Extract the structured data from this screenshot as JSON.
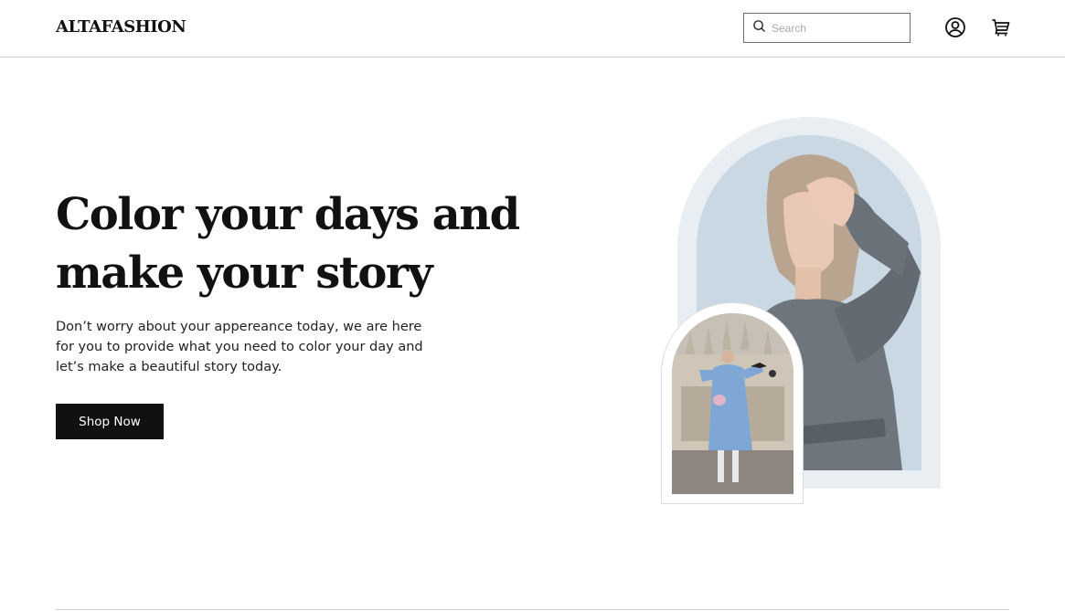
{
  "header": {
    "logo": "ALTAFASHION",
    "search": {
      "placeholder": "Search",
      "value": "",
      "icon": "search-icon"
    },
    "icons": {
      "account": "user-circle-icon",
      "cart": "cart-icon"
    }
  },
  "hero": {
    "headline": "Color your days and make your story",
    "description": "Don’t worry about your appereance today, we are here for you to provide what you need to color your day and let’s make a beautiful story today.",
    "cta_label": "Shop Now"
  },
  "colors": {
    "text": "#111111",
    "button_bg": "#111111",
    "button_text": "#ffffff",
    "arch_outer": "#e9eef2",
    "arch_inner": "#c6d6e1",
    "divider": "#cfcfcf"
  }
}
